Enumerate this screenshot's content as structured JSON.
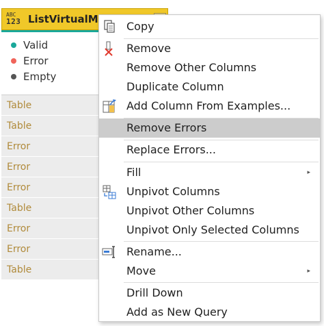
{
  "column": {
    "type_icon_top": "ABC",
    "type_icon_bottom": "123",
    "name": "ListVirtualMac",
    "quality": {
      "valid": "Valid",
      "error": "Error",
      "empty": "Empty"
    },
    "cells": [
      "Table",
      "Table",
      "Error",
      "Error",
      "Error",
      "Table",
      "Error",
      "Error",
      "Table"
    ]
  },
  "colors": {
    "header": "#f0c829",
    "valid": "#1aa89a",
    "error": "#f0645a",
    "empty": "#555555",
    "cell_text": "#b08a3a",
    "highlight": "#cccccc"
  },
  "menu": {
    "copy": "Copy",
    "remove": "Remove",
    "remove_other_columns": "Remove Other Columns",
    "duplicate_column": "Duplicate Column",
    "add_column_from_examples": "Add Column From Examples...",
    "remove_errors": "Remove Errors",
    "replace_errors": "Replace Errors...",
    "fill": "Fill",
    "unpivot_columns": "Unpivot Columns",
    "unpivot_other_columns": "Unpivot Other Columns",
    "unpivot_only_selected_columns": "Unpivot Only Selected Columns",
    "rename": "Rename...",
    "move": "Move",
    "drill_down": "Drill Down",
    "add_as_new_query": "Add as New Query",
    "submenu_arrow": "▸",
    "highlighted_item": "Remove Errors",
    "icons": {
      "copy": "copy-icon",
      "remove": "remove-column-icon",
      "add_column_from_examples": "add-column-from-examples-icon",
      "unpivot_columns": "unpivot-columns-icon",
      "rename": "rename-icon"
    }
  }
}
